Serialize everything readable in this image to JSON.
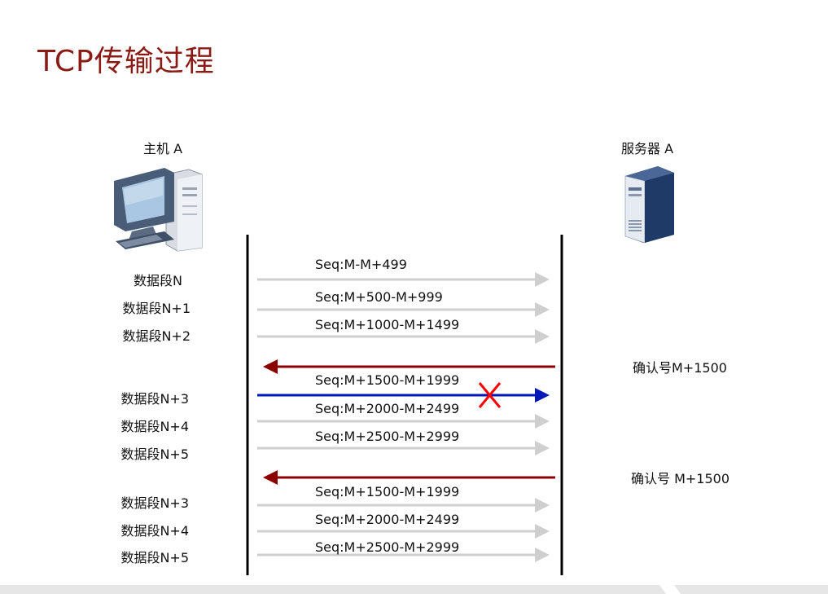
{
  "title": "TCP传输过程",
  "host": {
    "label": "主机 A",
    "icon": "desktop-computer-icon"
  },
  "server": {
    "label": "服务器 A",
    "icon": "server-tower-icon"
  },
  "colors": {
    "title": "#8b1a14",
    "data_arrow": "#cfcfcf",
    "ack_arrow": "#8b0000",
    "highlight_arrow": "#0018b8",
    "lost_mark": "#ff0000",
    "timeline": "#000000"
  },
  "segments": [
    {
      "label": "数据段N",
      "seq": "Seq:M-M+499"
    },
    {
      "label": "数据段N+1",
      "seq": "Seq:M+500-M+999"
    },
    {
      "label": "数据段N+2",
      "seq": "Seq:M+1000-M+1499"
    }
  ],
  "ack1": {
    "label": "确认号M+1500"
  },
  "segments2": [
    {
      "label": "数据段N+3",
      "seq": "Seq:M+1500-M+1999",
      "lost": true
    },
    {
      "label": "数据段N+4",
      "seq": "Seq:M+2000-M+2499"
    },
    {
      "label": "数据段N+5",
      "seq": "Seq:M+2500-M+2999"
    }
  ],
  "ack2": {
    "label": "确认号 M+1500"
  },
  "segments3": [
    {
      "label": "数据段N+3",
      "seq": "Seq:M+1500-M+1999"
    },
    {
      "label": "数据段N+4",
      "seq": "Seq:M+2000-M+2499"
    },
    {
      "label": "数据段N+5",
      "seq": "Seq:M+2500-M+2999"
    }
  ]
}
